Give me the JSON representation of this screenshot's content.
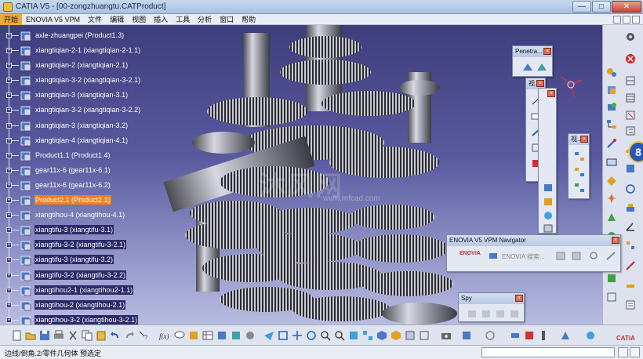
{
  "window": {
    "title": "CATIA V5 - [00-zongzhuangtu.CATProduct]",
    "min_label": "—",
    "max_label": "□",
    "close_label": "✕"
  },
  "menu": {
    "items": [
      "开始",
      "ENOVIA V5 VPM",
      "文件",
      "编辑",
      "视图",
      "插入",
      "工具",
      "分析",
      "窗口",
      "帮助"
    ]
  },
  "tree": {
    "items": [
      {
        "label": "axle-zhuangpei (Product1.3)",
        "state": "normal"
      },
      {
        "label": "xiangtiqian-2-1 (xiangtiqian-2-1.1)",
        "state": "normal"
      },
      {
        "label": "xiangtiqian-2 (xiangtiqian-2.1)",
        "state": "normal"
      },
      {
        "label": "xiangtiqian-3-2 (xiangtiqian-3-2.1)",
        "state": "normal"
      },
      {
        "label": "xiangtiqian-3 (xiangtiqian-3.1)",
        "state": "normal"
      },
      {
        "label": "xiangtiqian-3-2 (xiangtiqian-3-2.2)",
        "state": "normal"
      },
      {
        "label": "xiangtiqian-3 (xiangtiqian-3.2)",
        "state": "normal"
      },
      {
        "label": "xiangtiqian-4 (xiangtiqian-4.1)",
        "state": "normal"
      },
      {
        "label": "Product1.1 (Product1.4)",
        "state": "normal"
      },
      {
        "label": "gear11x-6 (gear11x-6.1)",
        "state": "normal"
      },
      {
        "label": "gear11x-6 (gear11x-6.2)",
        "state": "normal"
      },
      {
        "label": "Product2.1 (Product2.1)",
        "state": "highlight"
      },
      {
        "label": "xiangtihou-4 (xiangtihou-4.1)",
        "state": "normal"
      },
      {
        "label": "xiangtifu-3 (xiangtifu-3.1)",
        "state": "selected"
      },
      {
        "label": "xiangtifu-3-2 (xiangtifu-3-2.1)",
        "state": "selected"
      },
      {
        "label": "xiangtifu-3 (xiangtifu-3.2)",
        "state": "selected"
      },
      {
        "label": "xiangtifu-3-2 (xiangtifu-3-2.2)",
        "state": "selected"
      },
      {
        "label": "xiangtihou2-1 (xiangtihou2-1.1)",
        "state": "selected"
      },
      {
        "label": "xiangtihou-2 (xiangtihou-2.1)",
        "state": "selected"
      },
      {
        "label": "xiangtihou-3-2 (xiangtihou-3-2.1)",
        "state": "selected"
      }
    ]
  },
  "watermark": {
    "text": "沐风网",
    "url": "www.mfcad.com"
  },
  "floating": {
    "penetration_title": "Penetra...",
    "tb2_title": "视...",
    "tb3_title": "视...",
    "enovia_title": "ENOVIA V5 VPM Navigator",
    "enovia_item": "ENOVIA 搜索...",
    "enovia_logo": "ENOVIA",
    "spy_title": "Spy"
  },
  "badge": {
    "value": "8"
  },
  "status": {
    "text": "边线/倒角.2/零件几何体 预选定"
  },
  "branding": {
    "logo": "CATIA"
  },
  "colors": {
    "viewport_top": "#3e3d7c",
    "viewport_bottom": "#b8bce0",
    "highlight": "#f08020",
    "selected": "#2c2b6a"
  }
}
